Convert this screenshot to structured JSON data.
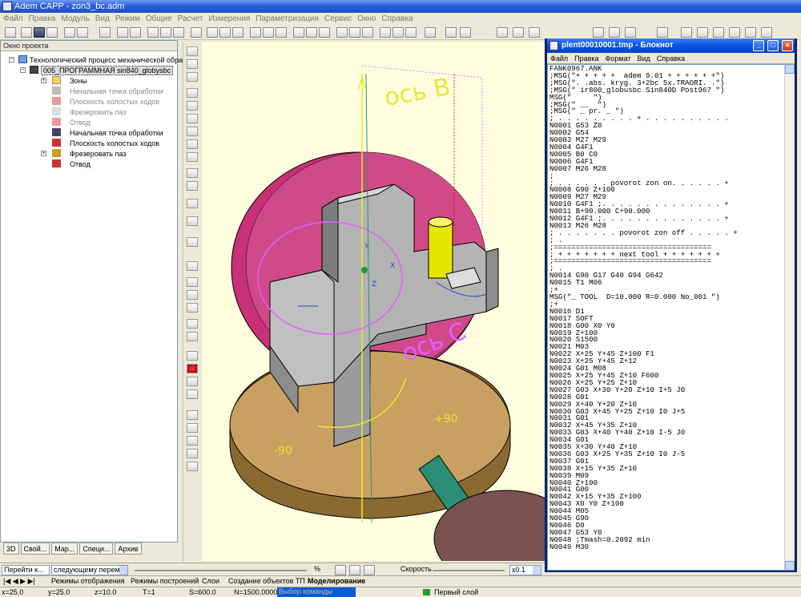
{
  "window": {
    "title": "Adem CAPP - zon3_bc.adm"
  },
  "menu": [
    "Файл",
    "Правка",
    "Модуль",
    "Вид",
    "Режим",
    "Общие",
    "Расчет",
    "Измерения",
    "Параметризация",
    "Сервис",
    "Окно",
    "Справка"
  ],
  "project_panel": {
    "title": "Окно проекта",
    "items": [
      {
        "label": "Технологический процесс механической обработ",
        "state": "normal"
      },
      {
        "label": "005_ПРОГРАММНАЯ sin840_globysbc",
        "state": "selected"
      },
      {
        "label": "Зоны",
        "state": "normal"
      },
      {
        "label": "Начальная точка обработки",
        "state": "grey"
      },
      {
        "label": "Плоскость холостых ходов",
        "state": "grey"
      },
      {
        "label": "Фрезеровать паз",
        "state": "grey"
      },
      {
        "label": "Отвод",
        "state": "grey"
      },
      {
        "label": "Начальная точка обработки",
        "state": "normal"
      },
      {
        "label": "Плоскость холостых ходов",
        "state": "normal"
      },
      {
        "label": "Фрезеровать паз",
        "state": "normal"
      },
      {
        "label": "Отвод",
        "state": "normal"
      }
    ],
    "tabs": [
      "3D",
      "Свой...",
      "Мар...",
      "Специ...",
      "Архив"
    ]
  },
  "viewport": {
    "labels": {
      "axis_b": "ось B",
      "axis_c": "ось C",
      "plus90": "+90",
      "minus90": "-90",
      "axis_x": "X",
      "axis_y": "Y",
      "axis_z": "Z"
    },
    "colors": {
      "background": "#ffffe0",
      "disc": "#c8307a",
      "table": "#c8a062",
      "part": "#b4b4b4",
      "tool": "#e6e600",
      "annot": "#e85cff"
    }
  },
  "notepad": {
    "title": "plent00010001.tmp - Блокнот",
    "menu": [
      "Файл",
      "Правка",
      "Формат",
      "Вид",
      "Справка"
    ],
    "lines": [
      "FANK0967.ANK",
      ";MSG(\"+ + + + +  adem 9.01 + + + + + +\")",
      ";MSG(\". .abs. kryg. 3+2bc 5x.TRAORI. .\")",
      ";MSG(\" ir800_globusbc Sin840D Post967 \")",
      "MSG(\"     \")",
      ";MSG(\" __  \")",
      ";MSG(\" _ pr. _ \")",
      "; . . . . . . . . . + . . . . . . . . . .",
      "N0001 G53 Z0",
      "N0002 G54",
      "N0003 M27 M29",
      "N0004 G4F1",
      "N0005 B0 C0",
      "N0006 G4F1",
      "N0007 M26 M28",
      ";",
      "; . . . . . . povorot zon on. . . . . . +",
      "N0008 G90 Z+100",
      "N0009 M27 M29",
      "N0010 G4F1 ;. . . . . . . . . . . . . . +",
      "N0011 B+90.000 C+90.000",
      "N0012 G4F1 ;. . . . . . . . . . . . . . +",
      "N0013 M26 M28",
      "; . . . . . . . povorot zon off . . . . . +",
      "; .",
      ";====================================",
      "; + + + + + + + next tool + + + + + + +",
      ";====================================",
      "; .",
      "N0014 G90 G17 G40 G94 G642",
      "N0015 T1 M06",
      ";+",
      "MSG(\"_ TOOL  D=10.000 R=0.000 No_001 \")",
      ";+",
      "N0016 D1",
      "N0017 SOFT",
      "N0018 G00 X0 Y0",
      "N0019 Z+100",
      "N0020 S1500",
      "N0021 M03",
      "N0022 X+25 Y+45 Z+100 F1",
      "N0023 X+25 Y+45 Z+12",
      "N0024 G01 M08",
      "N0025 X+25 Y+45 Z+10 F600",
      "N0026 X+25 Y+25 Z+10",
      "N0027 G03 X+30 Y+20 Z+10 I+5 J0",
      "N0028 G01",
      "N0029 X+40 Y+20 Z+10",
      "N0030 G03 X+45 Y+25 Z+10 I0 J+5",
      "N0031 G01",
      "N0032 X+45 Y+35 Z+10",
      "N0033 G03 X+40 Y+40 Z+10 I-5 J0",
      "N0034 G01",
      "N0035 X+30 Y+40 Z+10",
      "N0036 G03 X+25 Y+35 Z+10 I0 J-5",
      "N0037 G01",
      "N0038 X+15 Y+35 Z+10",
      "N0039 M09",
      "N0040 Z+100",
      "N0041 G00",
      "N0042 X+15 Y+35 Z+100",
      "N0043 X0 Y0 Z+100",
      "N0044 M05",
      "N0045 G90",
      "N0046 D0",
      "N0047 G53 Y0",
      "N0048 ;Tmash=0.2092 min",
      "N0049 M30"
    ]
  },
  "sim_bar": {
    "goto_label": "Перейти к...",
    "mode": "следующему перемещен",
    "percent": "%",
    "speed_label": "Скорость",
    "speed_value": "x0.1"
  },
  "doc_tabs": [
    "Режимы отображения",
    "Режимы построений",
    "Слои",
    "Создание объектов ТП",
    "Моделирование"
  ],
  "status": {
    "x": "x=25.0",
    "y": "y=25.0",
    "z": "z=10.0",
    "t": "T=1",
    "s": "S=600.0",
    "n": "N=1500.0000",
    "cmd": "Выбор команды",
    "layer": "Первый слой"
  }
}
